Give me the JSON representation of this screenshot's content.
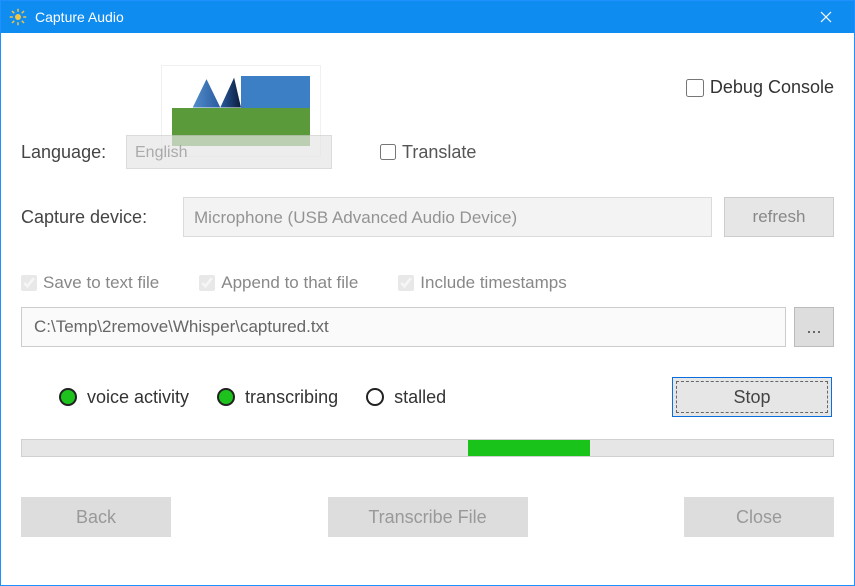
{
  "window": {
    "title": "Capture Audio"
  },
  "debug": {
    "label": "Debug Console",
    "checked": false
  },
  "language": {
    "label": "Language:",
    "value": "English",
    "translate_label": "Translate",
    "translate_checked": false
  },
  "device": {
    "label": "Capture device:",
    "value": "Microphone (USB Advanced Audio Device)",
    "refresh_label": "refresh"
  },
  "save": {
    "save_label": "Save to text file",
    "append_label": "Append to that file",
    "timestamps_label": "Include timestamps",
    "path": "C:\\Temp\\2remove\\Whisper\\captured.txt",
    "browse_label": "..."
  },
  "status": {
    "voice_label": "voice activity",
    "transcribing_label": "transcribing",
    "stalled_label": "stalled",
    "voice_on": true,
    "transcribing_on": true,
    "stalled_on": false,
    "stop_label": "Stop"
  },
  "progress": {
    "indeterminate_left_pct": 55,
    "indeterminate_width_pct": 15
  },
  "buttons": {
    "back": "Back",
    "transcribe": "Transcribe File",
    "close": "Close"
  }
}
